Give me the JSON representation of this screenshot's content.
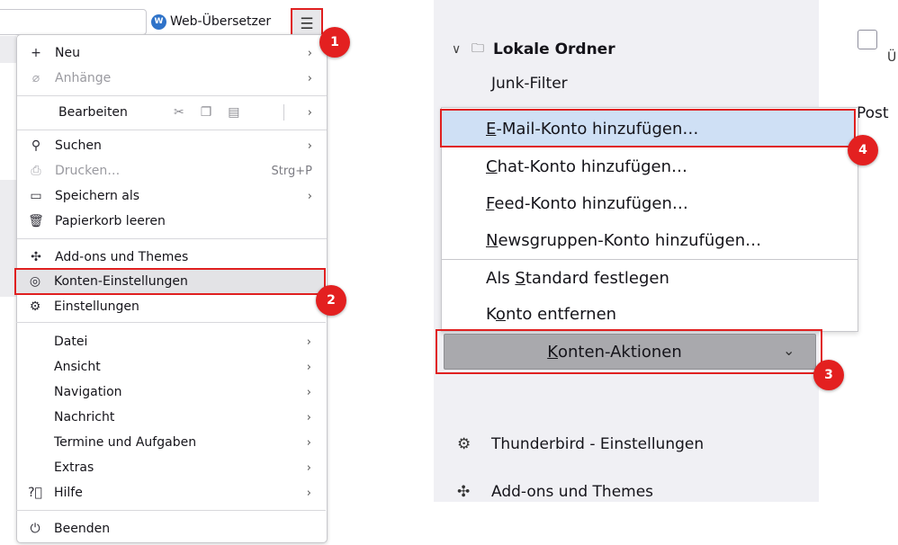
{
  "toolbar": {
    "translator_label": "Web-Übersetzer",
    "translator_logo_text": "W",
    "menu_icon": "hamburger-menu-icon"
  },
  "app_menu": {
    "items": [
      {
        "icon": "plus-icon",
        "label": "Neu",
        "arrow": "›",
        "disabled": false
      },
      {
        "icon": "paperclip-icon",
        "label": "Anhänge",
        "arrow": "›",
        "disabled": true
      },
      {
        "label": "Bearbeiten",
        "arrow": "›",
        "disabled": false
      },
      {
        "icon": "search-icon",
        "label": "Suchen",
        "arrow": "›",
        "disabled": false
      },
      {
        "icon": "printer-icon",
        "label": "Drucken…",
        "shortcut": "Strg+P",
        "disabled": true
      },
      {
        "icon": "save-folder-icon",
        "label": "Speichern als",
        "arrow": "›",
        "disabled": false
      },
      {
        "icon": "trash-icon",
        "label": "Papierkorb leeren",
        "disabled": false
      },
      {
        "icon": "puzzle-icon",
        "label": "Add-ons und Themes",
        "disabled": false
      },
      {
        "icon": "account-icon",
        "label": "Konten-Einstellungen",
        "disabled": false
      },
      {
        "icon": "gear-icon",
        "label": "Einstellungen",
        "disabled": false
      },
      {
        "label": "Datei",
        "arrow": "›"
      },
      {
        "label": "Ansicht",
        "arrow": "›"
      },
      {
        "label": "Navigation",
        "arrow": "›"
      },
      {
        "label": "Nachricht",
        "arrow": "›"
      },
      {
        "label": "Termine und Aufgaben",
        "arrow": "›"
      },
      {
        "label": "Extras",
        "arrow": "›"
      },
      {
        "icon": "help-icon",
        "label": "Hilfe",
        "arrow": "›"
      },
      {
        "icon": "power-icon",
        "label": "Beenden"
      }
    ],
    "edit_icons": [
      "cut-icon",
      "copy-icon",
      "paste-icon"
    ]
  },
  "account_pane": {
    "folder_label": "Lokale Ordner",
    "junk_label": "Junk-Filter",
    "content_partial_char": "Ü",
    "content_partial_text": "Post"
  },
  "context_menu": {
    "items": [
      {
        "pre": "",
        "key": "E",
        "post": "-Mail-Konto hinzufügen…"
      },
      {
        "pre": "",
        "key": "C",
        "post": "hat-Konto hinzufügen…"
      },
      {
        "pre": "",
        "key": "F",
        "post": "eed-Konto hinzufügen…"
      },
      {
        "pre": "",
        "key": "N",
        "post": "ewsgruppen-Konto hinzufügen…"
      },
      {
        "pre": "Als ",
        "key": "S",
        "post": "tandard festlegen"
      },
      {
        "pre": "K",
        "key": "o",
        "post": "nto entfernen"
      }
    ]
  },
  "actions_button": {
    "pre": "",
    "key": "K",
    "post": "onten-Aktionen",
    "chevron": "⌄"
  },
  "footer": {
    "settings_label": "Thunderbird - Einstellungen",
    "addons_label": "Add-ons und Themes"
  },
  "badges": [
    "1",
    "2",
    "3",
    "4"
  ],
  "colors": {
    "highlight_border": "#e02020",
    "badge": "#e32020",
    "selected_item": "#cfe0f5",
    "button": "#a9a9ad"
  }
}
